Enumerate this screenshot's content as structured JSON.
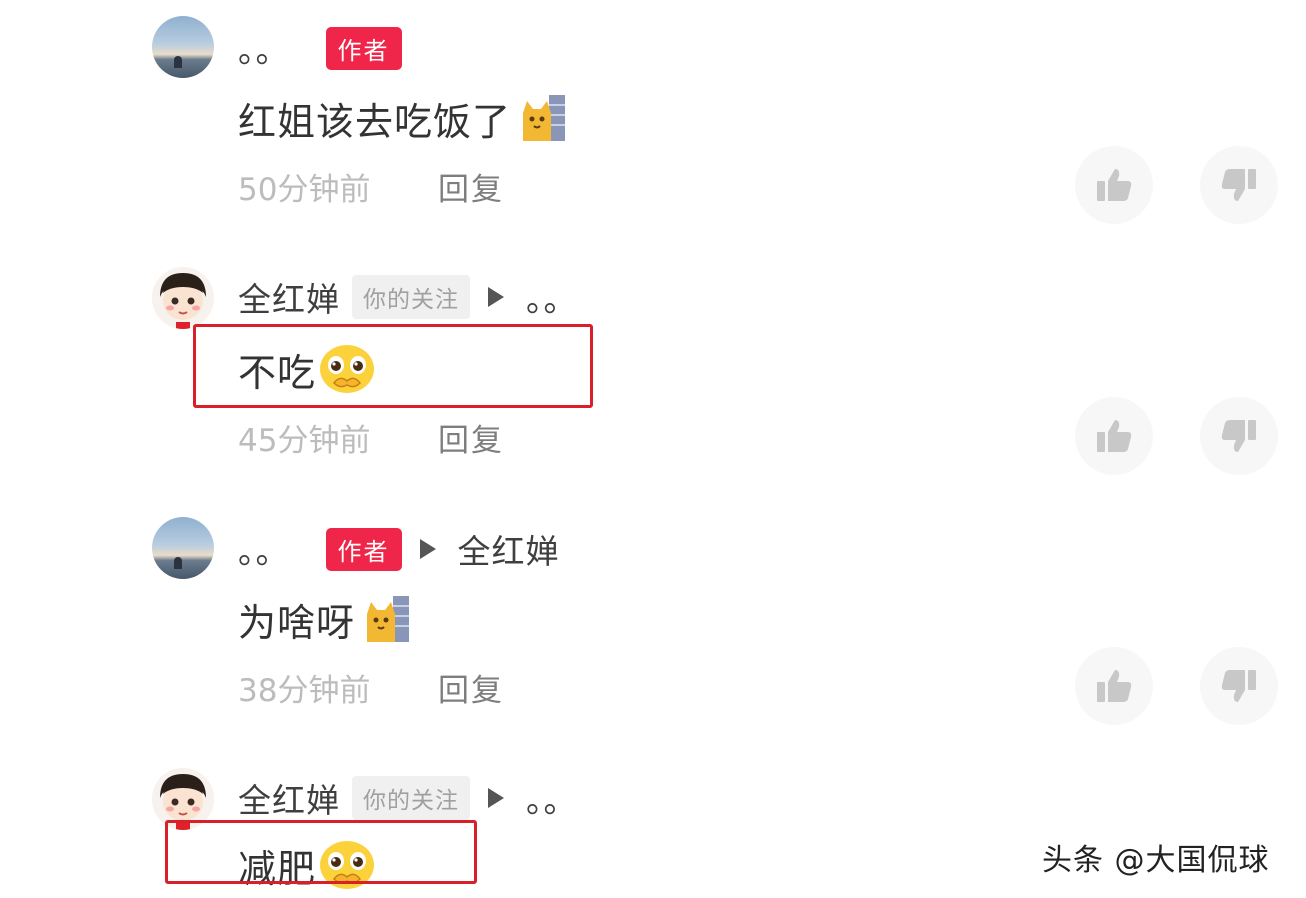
{
  "comments": [
    {
      "username": "。。",
      "badge": "作者",
      "content": "红姐该去吃饭了",
      "emoji": "cat-peek-emoji",
      "time": "50分钟前",
      "reply_label": "回复"
    },
    {
      "username": "全红婵",
      "badge": "你的关注",
      "reply_to": "。。",
      "content": "不吃",
      "emoji": "pleading-face-emoji",
      "time": "45分钟前",
      "reply_label": "回复"
    },
    {
      "username": "。。",
      "badge": "作者",
      "reply_to": "全红婵",
      "content": "为啥呀",
      "emoji": "cat-peek-emoji",
      "time": "38分钟前",
      "reply_label": "回复"
    },
    {
      "username": "全红婵",
      "badge": "你的关注",
      "reply_to": "。。",
      "content": "减肥",
      "emoji": "pleading-face-emoji"
    }
  ],
  "watermark": "头条 @大国侃球",
  "colors": {
    "author_badge": "#f0254a",
    "highlight_box": "#d9202a",
    "time_text": "#bcbcbc"
  }
}
